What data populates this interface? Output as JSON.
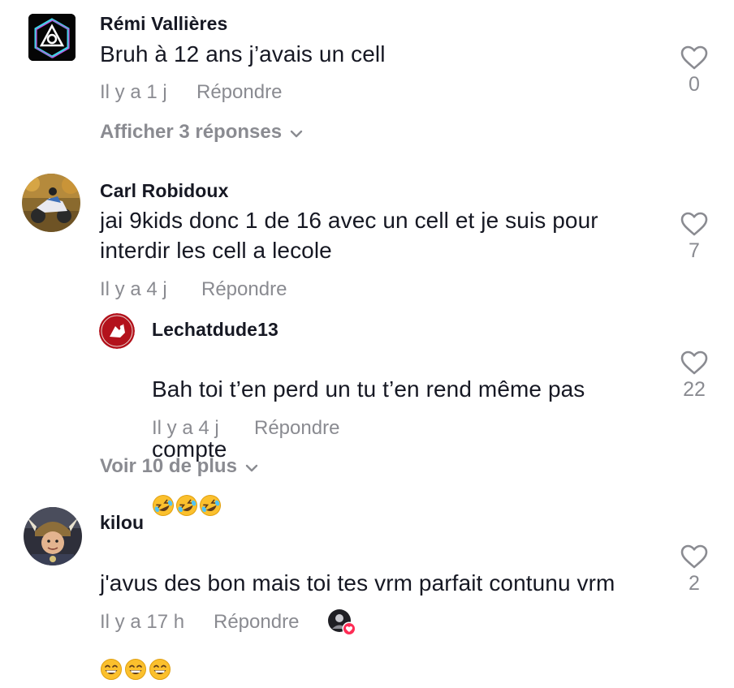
{
  "comments": [
    {
      "author": "Rémi Vallières",
      "text": "Bruh à 12 ans j’avais un cell",
      "time": "Il y a 1 j",
      "reply_label": "Répondre",
      "likes": "0",
      "expand_label": "Afficher 3 réponses",
      "avatar_icon": "linkin-park-logo"
    },
    {
      "author": "Carl Robidoux",
      "text": "jai 9kids donc 1 de 16 avec un cell et je suis pour\ninterdir les cell a lecole",
      "time": "Il y a 4 j",
      "reply_label": "Répondre",
      "likes": "7",
      "expand_label": "Voir 10 de plus",
      "avatar_icon": "motorcycle-photo",
      "replies": [
        {
          "author": "Lechatdude13",
          "text_line1": "Bah toi t’en perd un tu t’en rend même pas",
          "text_line2": "compte",
          "time": "Il y a 4 j",
          "reply_label": "Répondre",
          "likes": "22",
          "emoji": "rolling-on-floor-laughing",
          "avatar_icon": "red-cat-logo"
        }
      ]
    },
    {
      "author": "kilou",
      "text_line1": "j'avus des bon mais toi tes vrm parfait contunu vrm",
      "time": "Il y a 17 h",
      "reply_label": "Répondre",
      "likes": "2",
      "emoji": "grinning-face-with-smiling-eyes",
      "avatar_icon": "viking-photo",
      "creator_liked": true
    }
  ],
  "colors": {
    "text": "#161823",
    "muted": "#8a8b91",
    "like_red": "#fe2c55"
  }
}
